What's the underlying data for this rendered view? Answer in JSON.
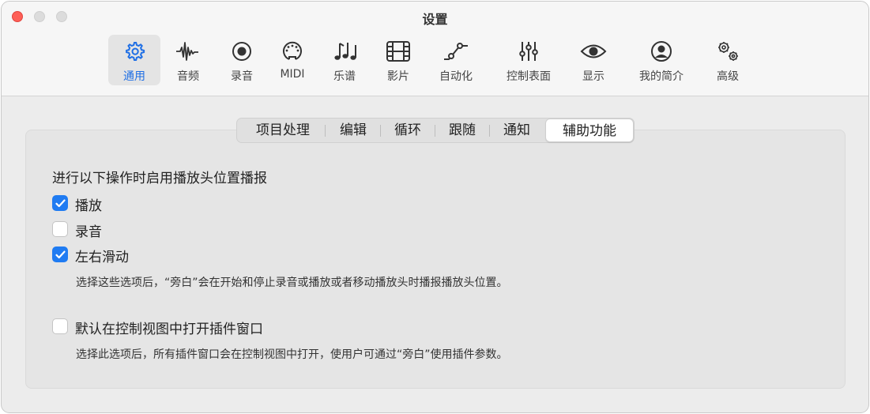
{
  "window": {
    "title": "设置"
  },
  "toolbar": {
    "items": [
      {
        "label": "通用",
        "icon": "gear-icon",
        "selected": true
      },
      {
        "label": "音频",
        "icon": "waveform-icon"
      },
      {
        "label": "录音",
        "icon": "record-icon"
      },
      {
        "label": "MIDI",
        "icon": "midi-connector-icon"
      },
      {
        "label": "乐谱",
        "icon": "music-notes-icon"
      },
      {
        "label": "影片",
        "icon": "film-icon"
      },
      {
        "label": "自动化",
        "icon": "automation-curve-icon"
      },
      {
        "label": "控制表面",
        "icon": "sliders-icon"
      },
      {
        "label": "显示",
        "icon": "eye-icon"
      },
      {
        "label": "我的简介",
        "icon": "person-icon"
      },
      {
        "label": "高级",
        "icon": "gears-icon"
      }
    ]
  },
  "tabs": {
    "items": [
      "项目处理",
      "编辑",
      "循环",
      "跟随",
      "通知",
      "辅助功能"
    ],
    "selected": "辅助功能"
  },
  "playhead_section": {
    "heading": "进行以下操作时启用播放头位置播报",
    "options": [
      {
        "label": "播放",
        "checked": true
      },
      {
        "label": "录音",
        "checked": false
      },
      {
        "label": "左右滑动",
        "checked": true
      }
    ],
    "help": "选择这些选项后，“旁白”会在开始和停止录音或播放或者移动播放头时播报播放头位置。"
  },
  "plugin_section": {
    "option": {
      "label": "默认在控制视图中打开插件窗口",
      "checked": false
    },
    "help": "选择此选项后，所有插件窗口会在控制视图中打开，使用户可通过“旁白”使用插件参数。"
  },
  "colors": {
    "accent": "#1f7bf2",
    "selected_label": "#1f6fe5",
    "close": "#fe5f57"
  }
}
